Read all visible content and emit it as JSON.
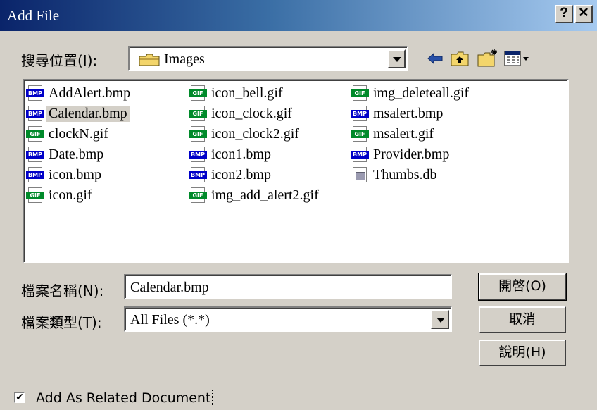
{
  "window": {
    "title": "Add File",
    "help_label": "?",
    "close_label": "✕"
  },
  "lookin": {
    "label": "搜尋位置(I):",
    "value": "Images",
    "folder_icon": "folder-icon"
  },
  "toolbar": {
    "back_icon": "back-arrow-icon",
    "up_icon": "up-folder-icon",
    "new_icon": "new-folder-icon",
    "view_icon": "view-menu-icon"
  },
  "files": [
    {
      "name": "AddAlert.bmp",
      "type": "BMP"
    },
    {
      "name": "Calendar.bmp",
      "type": "BMP",
      "selected": true
    },
    {
      "name": "clockN.gif",
      "type": "GIF"
    },
    {
      "name": "Date.bmp",
      "type": "BMP"
    },
    {
      "name": "icon.bmp",
      "type": "BMP"
    },
    {
      "name": "icon.gif",
      "type": "GIF"
    },
    {
      "name": "icon_bell.gif",
      "type": "GIF"
    },
    {
      "name": "icon_clock.gif",
      "type": "GIF"
    },
    {
      "name": "icon_clock2.gif",
      "type": "GIF"
    },
    {
      "name": "icon1.bmp",
      "type": "BMP"
    },
    {
      "name": "icon2.bmp",
      "type": "BMP"
    },
    {
      "name": "img_add_alert2.gif",
      "type": "GIF"
    },
    {
      "name": "img_deleteall.gif",
      "type": "GIF"
    },
    {
      "name": "msalert.bmp",
      "type": "BMP"
    },
    {
      "name": "msalert.gif",
      "type": "GIF"
    },
    {
      "name": "Provider.bmp",
      "type": "BMP"
    },
    {
      "name": "Thumbs.db",
      "type": "DB"
    }
  ],
  "filename": {
    "label": "檔案名稱(N):",
    "value": "Calendar.bmp"
  },
  "filetype": {
    "label": "檔案類型(T):",
    "value": "All Files (*.*)"
  },
  "buttons": {
    "open": "開啓(O)",
    "cancel": "取消",
    "help": "說明(H)"
  },
  "checkbox": {
    "label": "Add As Related Document",
    "checked": true,
    "mark": "✔"
  },
  "colors": {
    "title_start": "#0a246a",
    "title_end": "#a6caf0",
    "bmp": "#0000c8",
    "gif": "#008a2a",
    "face": "#d4d0c8"
  }
}
